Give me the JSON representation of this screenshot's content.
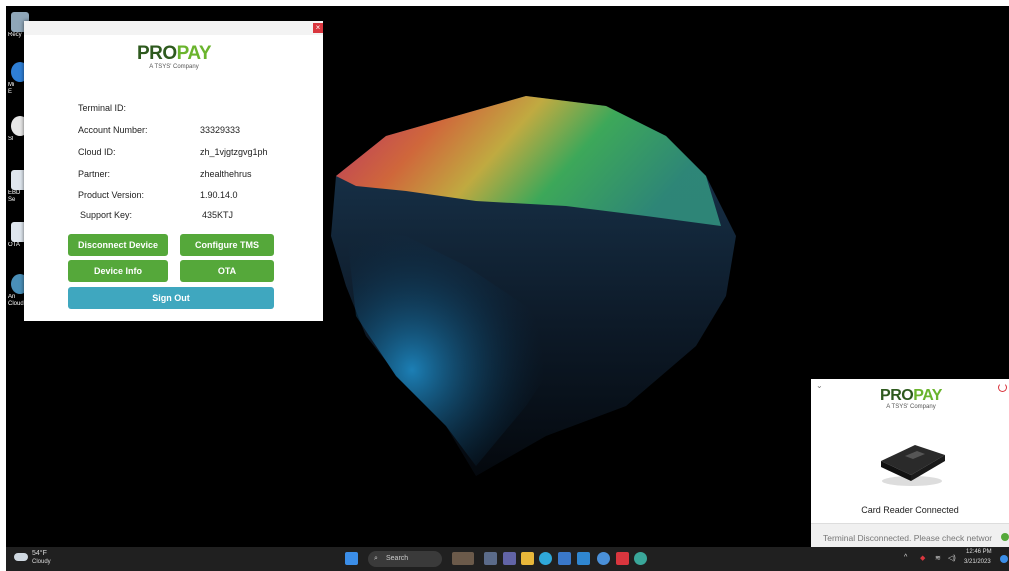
{
  "desktop": {
    "icons": [
      {
        "label": "Recy"
      },
      {
        "label": "Mi\nE"
      },
      {
        "label": "Sl"
      },
      {
        "label": "EBD\nSe"
      },
      {
        "label": "OTA"
      },
      {
        "label": "An\nCloud"
      }
    ]
  },
  "main_window": {
    "close_label": "×",
    "logo": {
      "pro": "PRO",
      "pay": "PAY",
      "tagline": "A TSYS' Company"
    },
    "fields": [
      {
        "label": "Terminal ID:",
        "value": ""
      },
      {
        "label": "Account Number:",
        "value": "33329333"
      },
      {
        "label": "Cloud ID:",
        "value": "zh_1vjgtzgvg1ph"
      },
      {
        "label": "Partner:",
        "value": "zhealthehrus"
      },
      {
        "label": "Product Version:",
        "value": "1.90.14.0"
      },
      {
        "label": "Support Key:",
        "value": "435KTJ"
      }
    ],
    "buttons": {
      "disconnect": "Disconnect Device",
      "configure": "Configure TMS",
      "device_info": "Device Info",
      "ota": "OTA",
      "sign_out": "Sign Out"
    }
  },
  "status_window": {
    "logo": {
      "pro": "PRO",
      "pay": "PAY",
      "tagline": "A TSYS' Company"
    },
    "reader_status": "Card Reader Connected",
    "terminal_status": "Terminal Disconnected. Please check networ"
  },
  "taskbar": {
    "weather_temp": "54°F",
    "weather_desc": "Cloudy",
    "search_label": "Search",
    "time": "12:46 PM",
    "date": "3/21/2023"
  },
  "colors": {
    "button_green": "#55a83a",
    "button_teal": "#3fa7bf",
    "pro": "#2e5a1e",
    "pay": "#6ab42d"
  }
}
